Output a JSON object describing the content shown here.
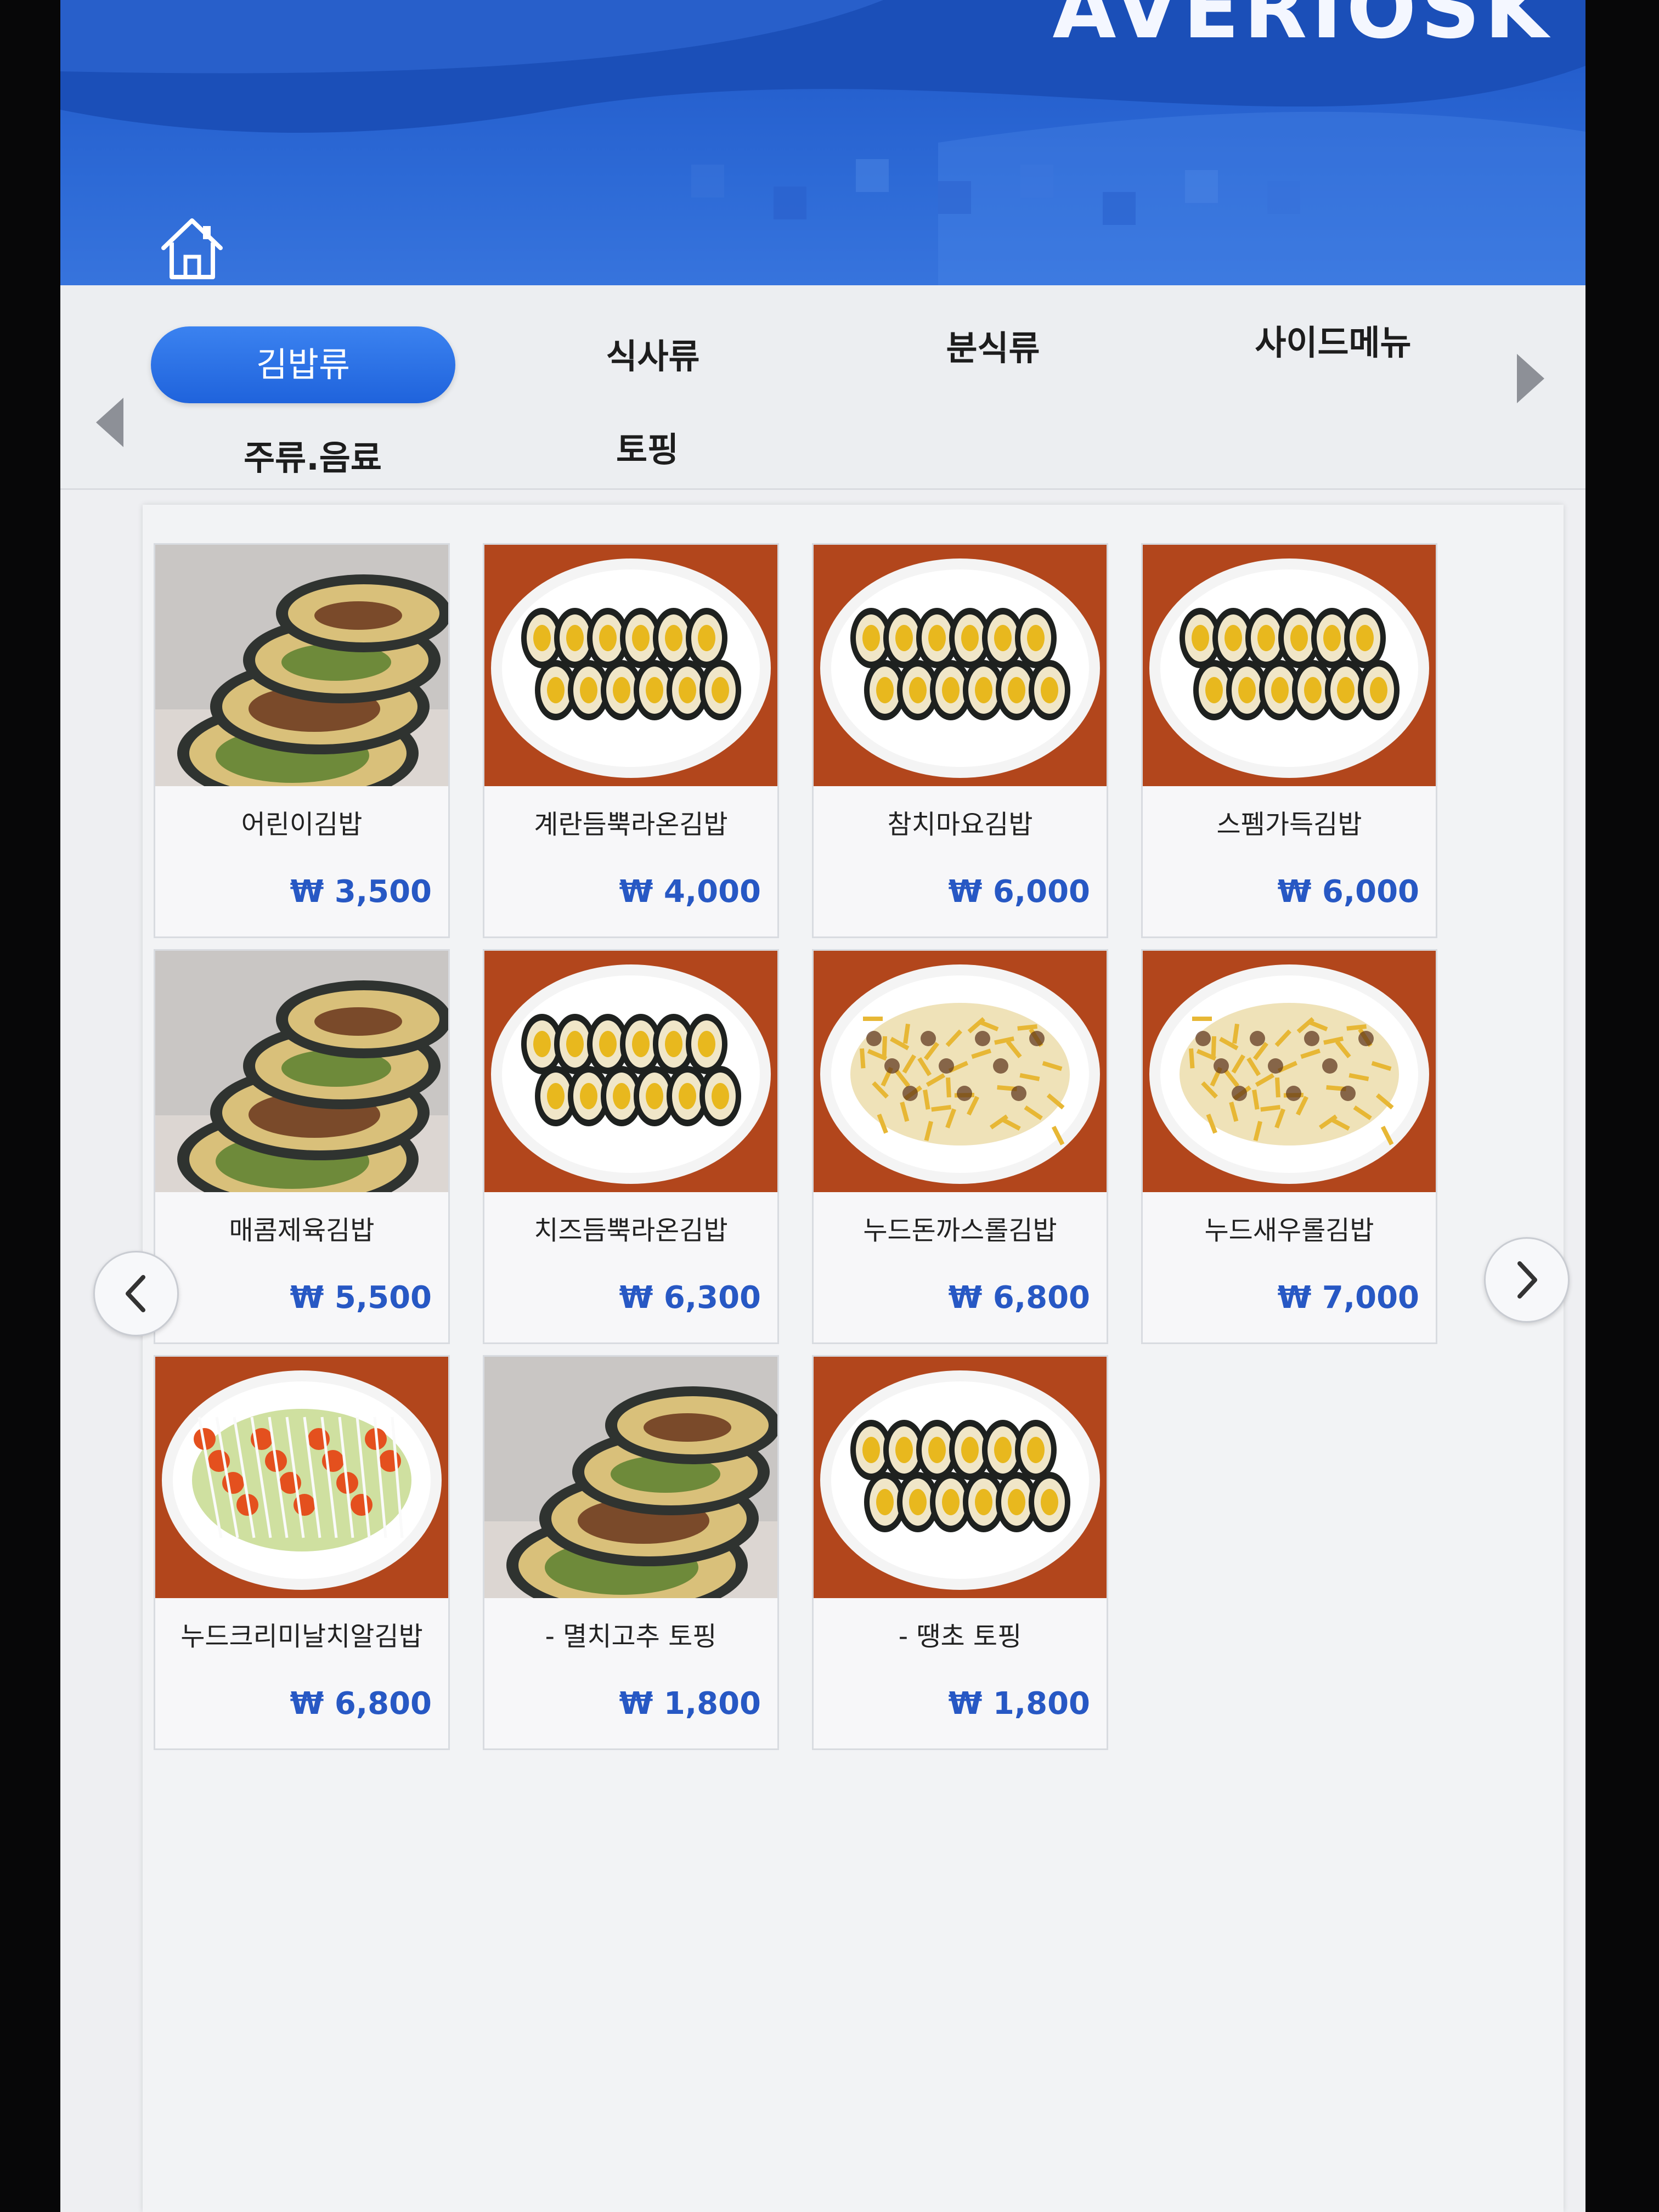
{
  "header": {
    "brand": "AVERIOSK",
    "home_icon": "home-icon"
  },
  "tabs": [
    {
      "label": "김밥류",
      "active": true
    },
    {
      "label": "식사류",
      "active": false
    },
    {
      "label": "분식류",
      "active": false
    },
    {
      "label": "사이드메뉴",
      "active": false
    },
    {
      "label": "주류.음료",
      "active": false
    },
    {
      "label": "토핑",
      "active": false
    }
  ],
  "tab_nav": {
    "prev_icon": "triangle-left-icon",
    "next_icon": "triangle-right-icon"
  },
  "page_nav": {
    "prev_icon": "chevron-left-icon",
    "next_icon": "chevron-right-icon"
  },
  "menu_items": [
    {
      "name": "어린이김밥",
      "price": "₩ 3,500",
      "photo": "gray"
    },
    {
      "name": "계란듬뿍라온김밥",
      "price": "₩ 4,000",
      "photo": "orange"
    },
    {
      "name": "참치마요김밥",
      "price": "₩ 6,000",
      "photo": "orange"
    },
    {
      "name": "스펨가득김밥",
      "price": "₩ 6,000",
      "photo": "orange"
    },
    {
      "name": "매콤제육김밥",
      "price": "₩ 5,500",
      "photo": "gray"
    },
    {
      "name": "치즈듬뿍라온김밥",
      "price": "₩ 6,300",
      "photo": "orange"
    },
    {
      "name": "누드돈까스롤김밥",
      "price": "₩ 6,800",
      "photo": "orange-topped"
    },
    {
      "name": "누드새우롤김밥",
      "price": "₩ 7,000",
      "photo": "orange-topped"
    },
    {
      "name": "누드크리미날치알김밥",
      "price": "₩ 6,800",
      "photo": "orange-green"
    },
    {
      "name": "- 멸치고추 토핑",
      "price": "₩ 1,800",
      "photo": "gray"
    },
    {
      "name": "- 땡초 토핑",
      "price": "₩ 1,800",
      "photo": "orange"
    }
  ],
  "colors": {
    "header_blue": "#2d6ad6",
    "active_tab": "#2a72e6",
    "price_blue": "#2758c4",
    "photo_orange": "#b2461c"
  }
}
